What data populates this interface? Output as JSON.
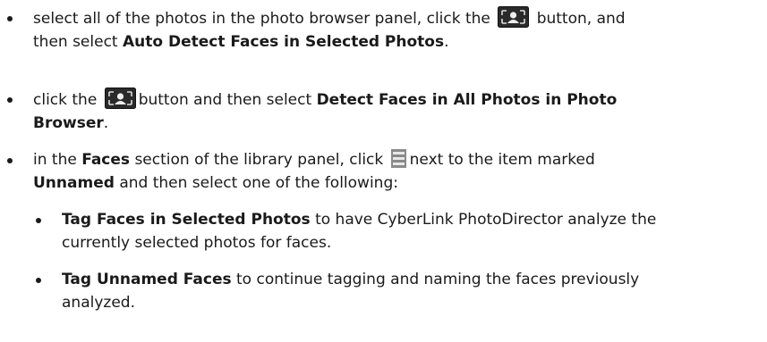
{
  "items": [
    {
      "pre": "select all of the photos in the photo browser panel, click the",
      "mid": "button, and",
      "line2_pre": "then select",
      "bold": "Auto Detect Faces in Selected Photos",
      "post": "."
    },
    {
      "pre": "click the",
      "mid": "button and then select",
      "bold": "Detect Faces in All Photos in Photo",
      "bold2": "Browser",
      "post": "."
    },
    {
      "pre": "in the",
      "bold": "Faces",
      "mid": "section of the library panel, click",
      "mid2": "next to the item marked",
      "bold2": "Unnamed",
      "post": "and then select one of the following:"
    },
    {
      "bold": "Tag Faces in Selected Photos",
      "post": "to have CyberLink PhotoDirector analyze the",
      "line2": "currently selected photos for faces."
    },
    {
      "bold": "Tag Unnamed Faces",
      "post": "to continue tagging and naming the faces previously",
      "line2": "analyzed."
    }
  ],
  "icons": {
    "face_detect": "face-detect-icon",
    "menu": "menu-icon"
  }
}
